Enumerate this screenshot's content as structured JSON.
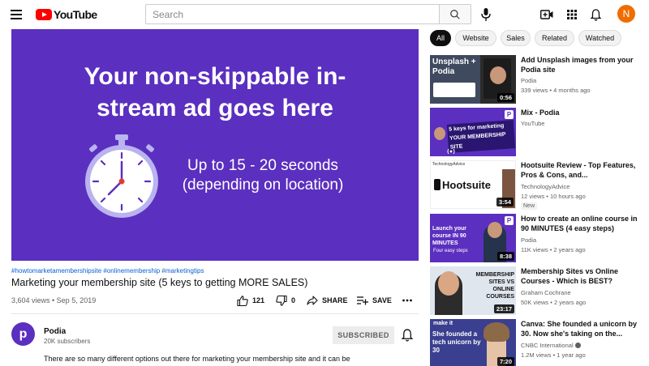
{
  "header": {
    "logo_text": "YouTube",
    "search_placeholder": "Search",
    "avatar_letter": "N",
    "avatar_color": "#ef6c00"
  },
  "player": {
    "background": "#5b2fbf",
    "headline_line1": "Your non-skippable in-",
    "headline_line2": "stream ad goes here",
    "sub_line1": "Up to 15 - 20 seconds",
    "sub_line2": "(depending on location)"
  },
  "video": {
    "hashtags": "#howtomarketamembershipsite #onlinemembership #marketingtips",
    "title": "Marketing your membership site (5 keys to getting MORE SALES)",
    "views_date": "3,604 views • Sep 5, 2019",
    "likes": "121",
    "dislikes": "0",
    "share_label": "SHARE",
    "save_label": "SAVE"
  },
  "channel": {
    "avatar_letter": "p",
    "name": "Podia",
    "subscribers": "20K subscribers",
    "subscribe_label": "SUBSCRIBED",
    "description": "There are so many different options out there for marketing your membership site and it can be"
  },
  "chips": [
    "All",
    "Website",
    "Sales",
    "Related",
    "Watched"
  ],
  "recommendations": [
    {
      "title": "Add Unsplash images from your Podia site",
      "channel": "Podia",
      "meta": "339 views • 4 months ago",
      "duration": "0:56",
      "thumb_text": "Unsplash + Podia"
    },
    {
      "title": "Mix - Podia",
      "channel": "YouTube",
      "meta": "",
      "duration": "",
      "thumb_text": "5 keys for marketing YOUR MEMBERSHIP SITE"
    },
    {
      "title": "Hootsuite Review - Top Features, Pros & Cons, and...",
      "channel": "TechnologyAdvice",
      "meta": "12 views • 10 hours ago",
      "duration": "3:54",
      "badge": "New",
      "thumb_text": "Hootsuite",
      "thumb_label": "TechnologyAdvice"
    },
    {
      "title": "How to create an online course in 90 MINUTES (4 easy steps)",
      "channel": "Podia",
      "meta": "11K views • 2 years ago",
      "duration": "8:38",
      "thumb_text": "Launch your course IN 90 MINUTES",
      "thumb_sub": "Four easy steps"
    },
    {
      "title": "Membership Sites vs Online Courses - Which is BEST?",
      "channel": "Graham Cochrane",
      "meta": "50K views • 2 years ago",
      "duration": "23:17",
      "thumb_text": "MEMBERSHIP SITES VS ONLINE COURSES"
    },
    {
      "title": "Canva: She founded a unicorn by 30. Now she's taking on the...",
      "channel": "CNBC International",
      "meta": "1.2M views • 1 year ago",
      "duration": "7:20",
      "thumb_text": "She founded a tech unicorn by 30",
      "thumb_brand": "make it"
    }
  ]
}
